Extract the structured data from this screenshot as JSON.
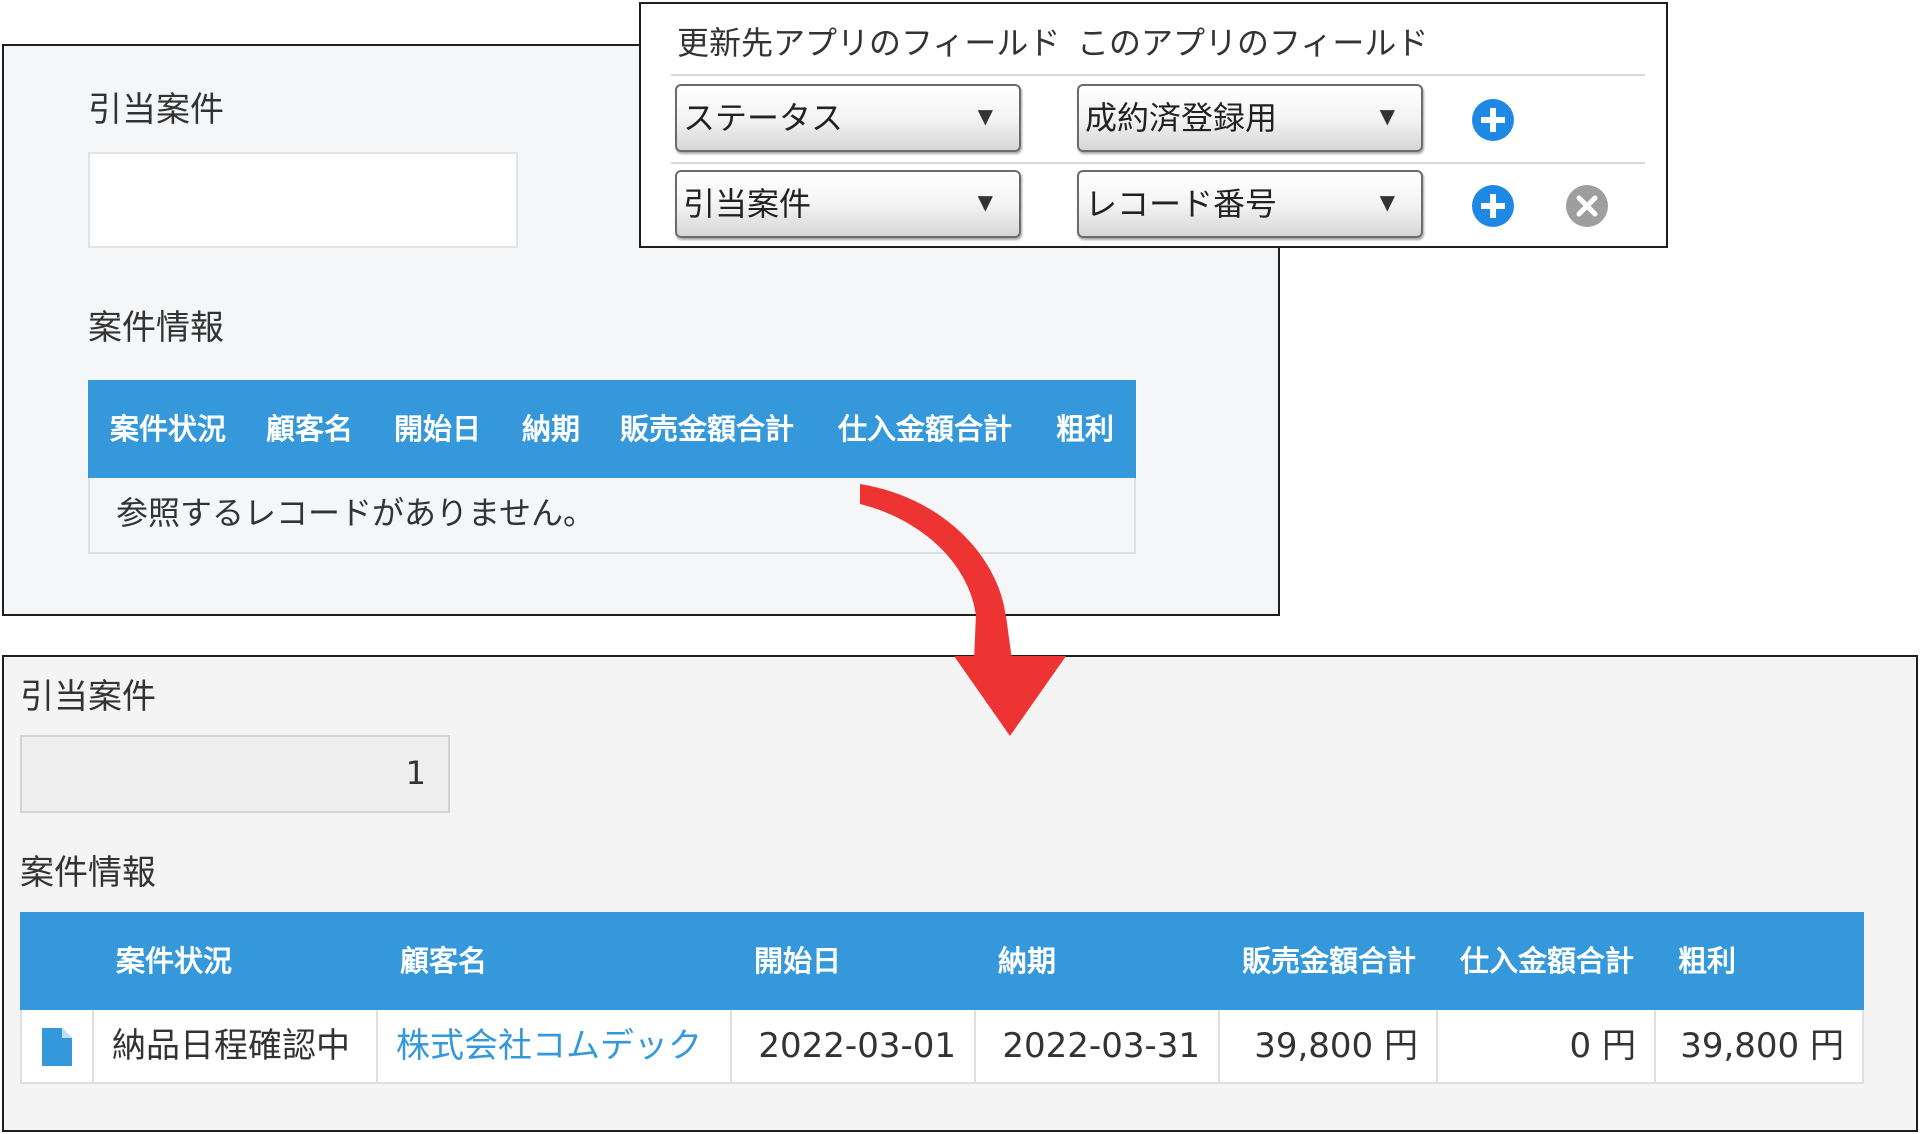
{
  "mapping_panel": {
    "header_dest": "更新先アプリのフィールド",
    "header_src": "このアプリのフィールド",
    "rows": [
      {
        "dest": "ステータス",
        "src": "成約済登録用"
      },
      {
        "dest": "引当案件",
        "src": "レコード番号"
      }
    ],
    "dropdown_arrow": "▼",
    "add_icon": "plus-circle-icon",
    "remove_icon": "x-circle-icon"
  },
  "before": {
    "field_label": "引当案件",
    "field_value": "",
    "section_label": "案件情報",
    "columns": [
      "案件状況",
      "顧客名",
      "開始日",
      "納期",
      "販売金額合計",
      "仕入金額合計",
      "粗利"
    ],
    "empty_message": "参照するレコードがありません。"
  },
  "after": {
    "field_label": "引当案件",
    "field_value": "1",
    "section_label": "案件情報",
    "columns": [
      "案件状況",
      "顧客名",
      "開始日",
      "納期",
      "販売金額合計",
      "仕入金額合計",
      "粗利"
    ],
    "row": {
      "icon": "document-icon",
      "status": "納品日程確認中",
      "customer": "株式会社コムデック",
      "start": "2022-03-01",
      "due": "2022-03-31",
      "sales": "39,800 円",
      "cost": "0 円",
      "profit": "39,800 円"
    }
  },
  "colors": {
    "header_blue": "#3498db",
    "arrow_red": "#ee3333",
    "add_blue": "#1e88e5",
    "remove_gray": "#9e9e9e"
  }
}
